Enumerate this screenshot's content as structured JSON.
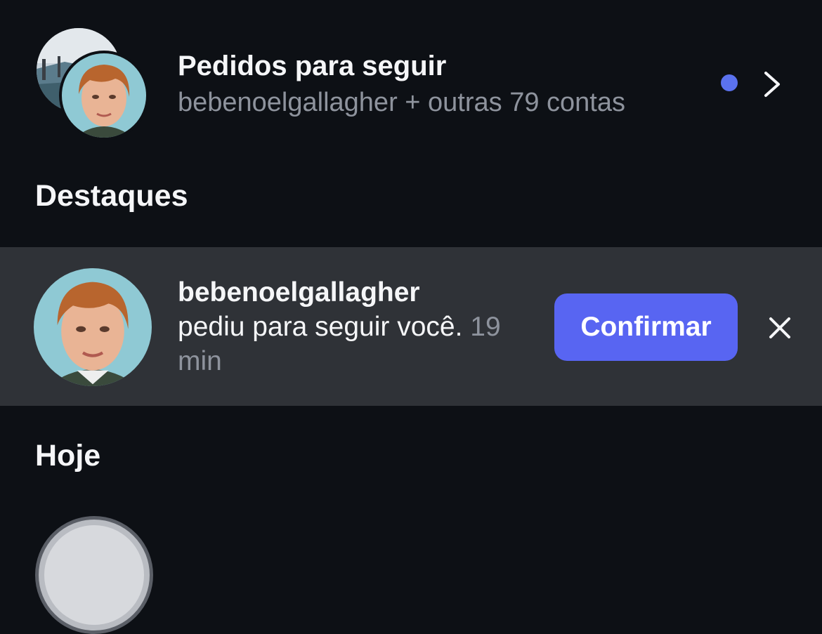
{
  "colors": {
    "background": "#0d1015",
    "card_background": "#2f3237",
    "accent": "#5865f2",
    "unread_dot": "#5b72ee",
    "secondary_text": "#8e939d"
  },
  "follow_requests": {
    "title": "Pedidos para seguir",
    "subtitle": "bebenoelgallagher + outras 79 contas",
    "unread": true,
    "icons": [
      "avatar",
      "avatar",
      "unread-dot-icon",
      "chevron-right-icon"
    ]
  },
  "sections": {
    "highlights_heading": "Destaques",
    "today_heading": "Hoje"
  },
  "highlight": {
    "username": "bebenoelgallagher",
    "message": "pediu para seguir você.",
    "time": "19 min",
    "confirm_label": "Confirmar",
    "dismiss_icon": "close-icon"
  }
}
